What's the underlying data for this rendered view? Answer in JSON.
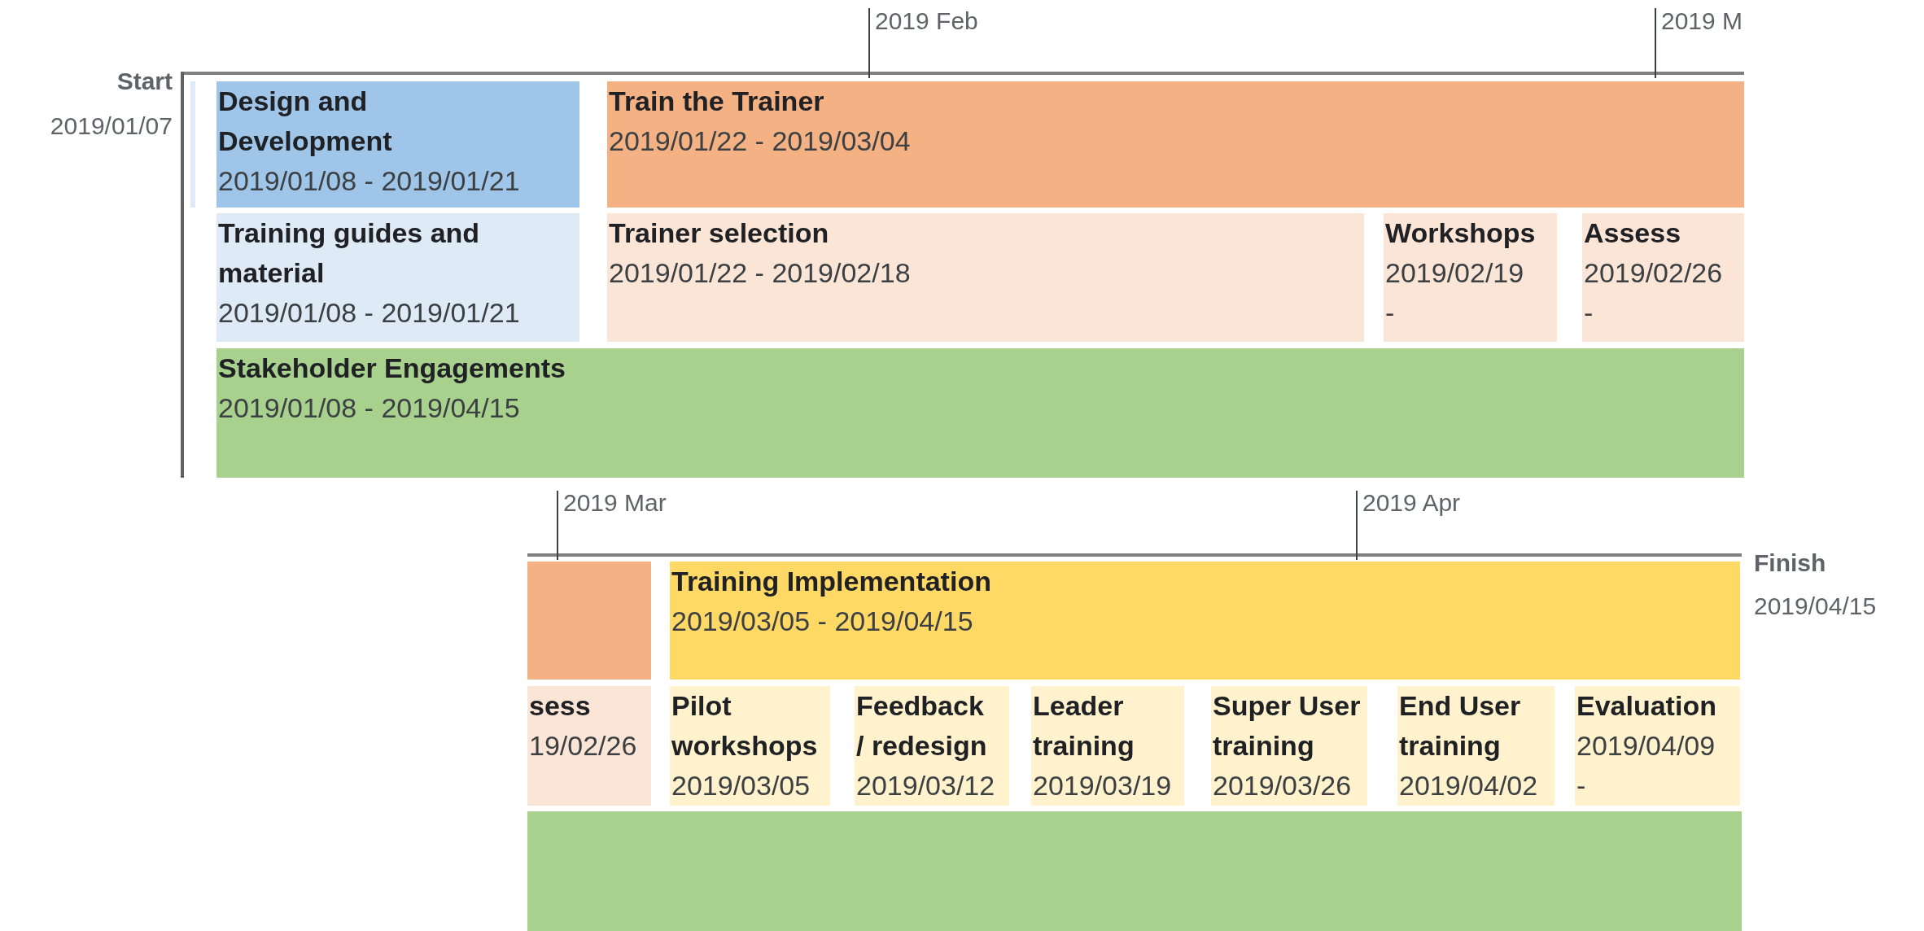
{
  "sections": [
    {
      "start": {
        "label": "Start",
        "date": "2019/01/07"
      },
      "ticks": [
        {
          "label": "2019 Feb"
        },
        {
          "label": "2019 M"
        }
      ],
      "tasks": [
        {
          "title": "Design and Development",
          "dates": "2019/01/08 - 2019/01/21",
          "color": "#9fc5e8"
        },
        {
          "title": "Train the Trainer",
          "dates": "2019/01/22 - 2019/03/04",
          "color": "#f4b183"
        },
        {
          "title": "Training guides and material",
          "dates": "2019/01/08 - 2019/01/21",
          "color": "#deeaf6"
        },
        {
          "title": "Trainer selection",
          "dates": "2019/01/22 - 2019/02/18",
          "color": "#fbe5d6"
        },
        {
          "title": "Workshops",
          "dates": "2019/02/19 -",
          "color": "#fbe5d6"
        },
        {
          "title": "Assess",
          "dates": "2019/02/26 -",
          "color": "#fbe5d6"
        },
        {
          "title": "Stakeholder Engagements",
          "dates": "2019/01/08 - 2019/04/15",
          "color": "#a9d18e"
        }
      ]
    },
    {
      "finish": {
        "label": "Finish",
        "date": "2019/04/15"
      },
      "ticks": [
        {
          "label": "2019 Mar"
        },
        {
          "label": "2019 Apr"
        }
      ],
      "tasks": [
        {
          "color": "#f4b183"
        },
        {
          "title": "Training Implementation",
          "dates": "2019/03/05 - 2019/04/15",
          "color": "#ffd966"
        },
        {
          "title": "sess",
          "dates": "19/02/26",
          "color": "#fbe5d6"
        },
        {
          "title": "Pilot workshops",
          "dates": "2019/03/05",
          "color": "#fff2cc"
        },
        {
          "title": "Feedback / redesign",
          "dates": "2019/03/12",
          "color": "#fff2cc"
        },
        {
          "title": "Leader training",
          "dates": "2019/03/19",
          "color": "#fff2cc"
        },
        {
          "title": "Super User training",
          "dates": "2019/03/26",
          "color": "#fff2cc"
        },
        {
          "title": "End User training",
          "dates": "2019/04/02",
          "color": "#fff2cc"
        },
        {
          "title": "Evaluation",
          "dates": "2019/04/09 -",
          "color": "#fff2cc"
        },
        {
          "color": "#a9d18e"
        }
      ]
    }
  ]
}
